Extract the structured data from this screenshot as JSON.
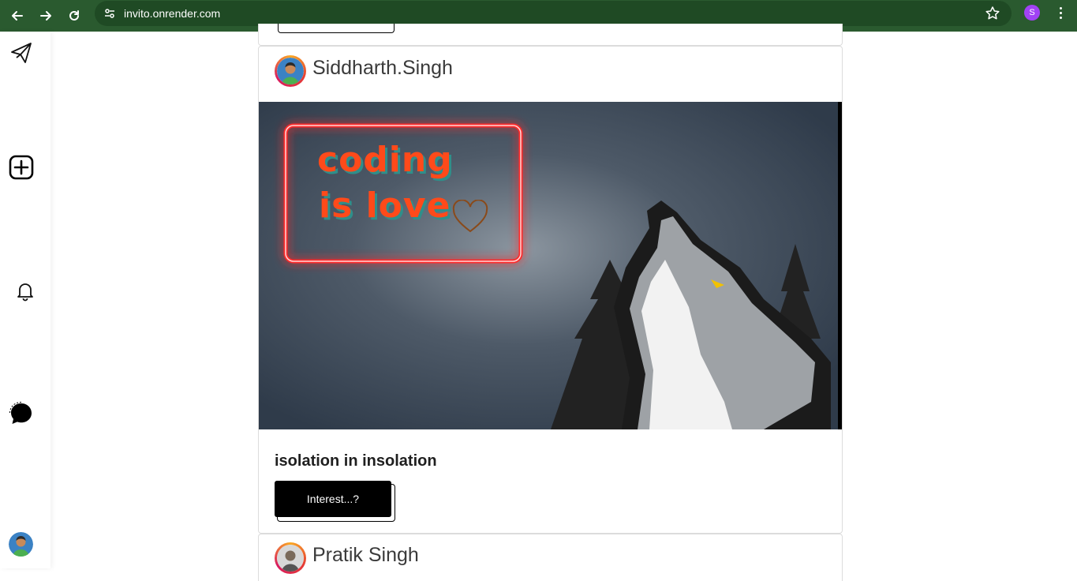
{
  "browser": {
    "url": "invito.onrender.com",
    "profile_initial": "S"
  },
  "sidebar": {
    "items": [
      {
        "name": "send",
        "icon": "paper-plane-icon"
      },
      {
        "name": "create",
        "icon": "plus-square-icon"
      },
      {
        "name": "notifications",
        "icon": "bell-icon"
      },
      {
        "name": "messages",
        "icon": "chat-bubble-icon"
      },
      {
        "name": "profile",
        "icon": "avatar"
      }
    ]
  },
  "feed": {
    "posts": [
      {
        "username": "Siddharth.Singh",
        "image_text_line1": "coding",
        "image_text_line2": "is love",
        "caption": "isolation in insolation",
        "button_label": "Interest...?"
      },
      {
        "username": "Pratik Singh"
      }
    ]
  },
  "colors": {
    "chrome_bg": "#2a5a2f",
    "omnibox_bg": "#1f4a24",
    "profile_dot": "#a142f4",
    "button_bg": "#000000",
    "neon_red": "#ff2a2a",
    "text_orange": "#ff4a1a"
  }
}
